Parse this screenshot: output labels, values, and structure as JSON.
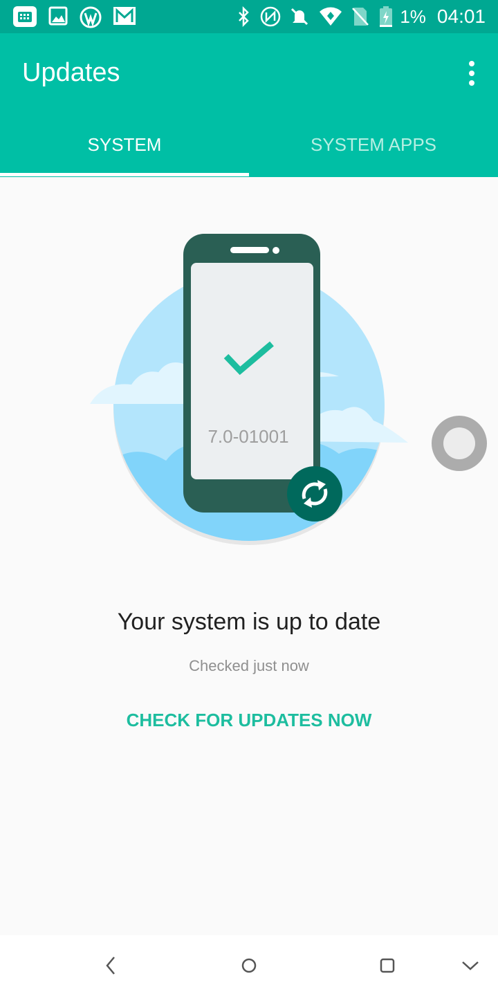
{
  "status_bar": {
    "battery_percent": "1%",
    "time": "04:01",
    "icons": [
      "calendar-icon",
      "image-icon",
      "wordpress-icon",
      "gmail-icon",
      "bluetooth-icon",
      "nfc-icon",
      "notifications-off-icon",
      "wifi-icon",
      "no-sim-icon",
      "battery-charging-icon"
    ]
  },
  "app_bar": {
    "title": "Updates",
    "menu_icon": "more-vert-icon"
  },
  "tabs": [
    {
      "label": "SYSTEM",
      "selected": true
    },
    {
      "label": "SYSTEM APPS",
      "selected": false
    }
  ],
  "illustration": {
    "version": "7.0-01001",
    "check_icon": "check-icon",
    "refresh_icon": "refresh-icon",
    "colors": {
      "phone_body": "#2a5f54",
      "screen": "#eceff1",
      "check": "#1dbd9f",
      "circle": "#b3e5fc",
      "cloud": "#e1f5fe"
    }
  },
  "content": {
    "headline": "Your system is up to date",
    "subtext": "Checked just now",
    "action_label": "CHECK FOR UPDATES NOW"
  },
  "colors": {
    "accent": "#00bfa5",
    "status_bar": "#00a892",
    "action": "#1dbd9f"
  },
  "nav_bar": {
    "icons": [
      "back-icon",
      "home-icon",
      "recents-icon",
      "collapse-icon"
    ]
  }
}
